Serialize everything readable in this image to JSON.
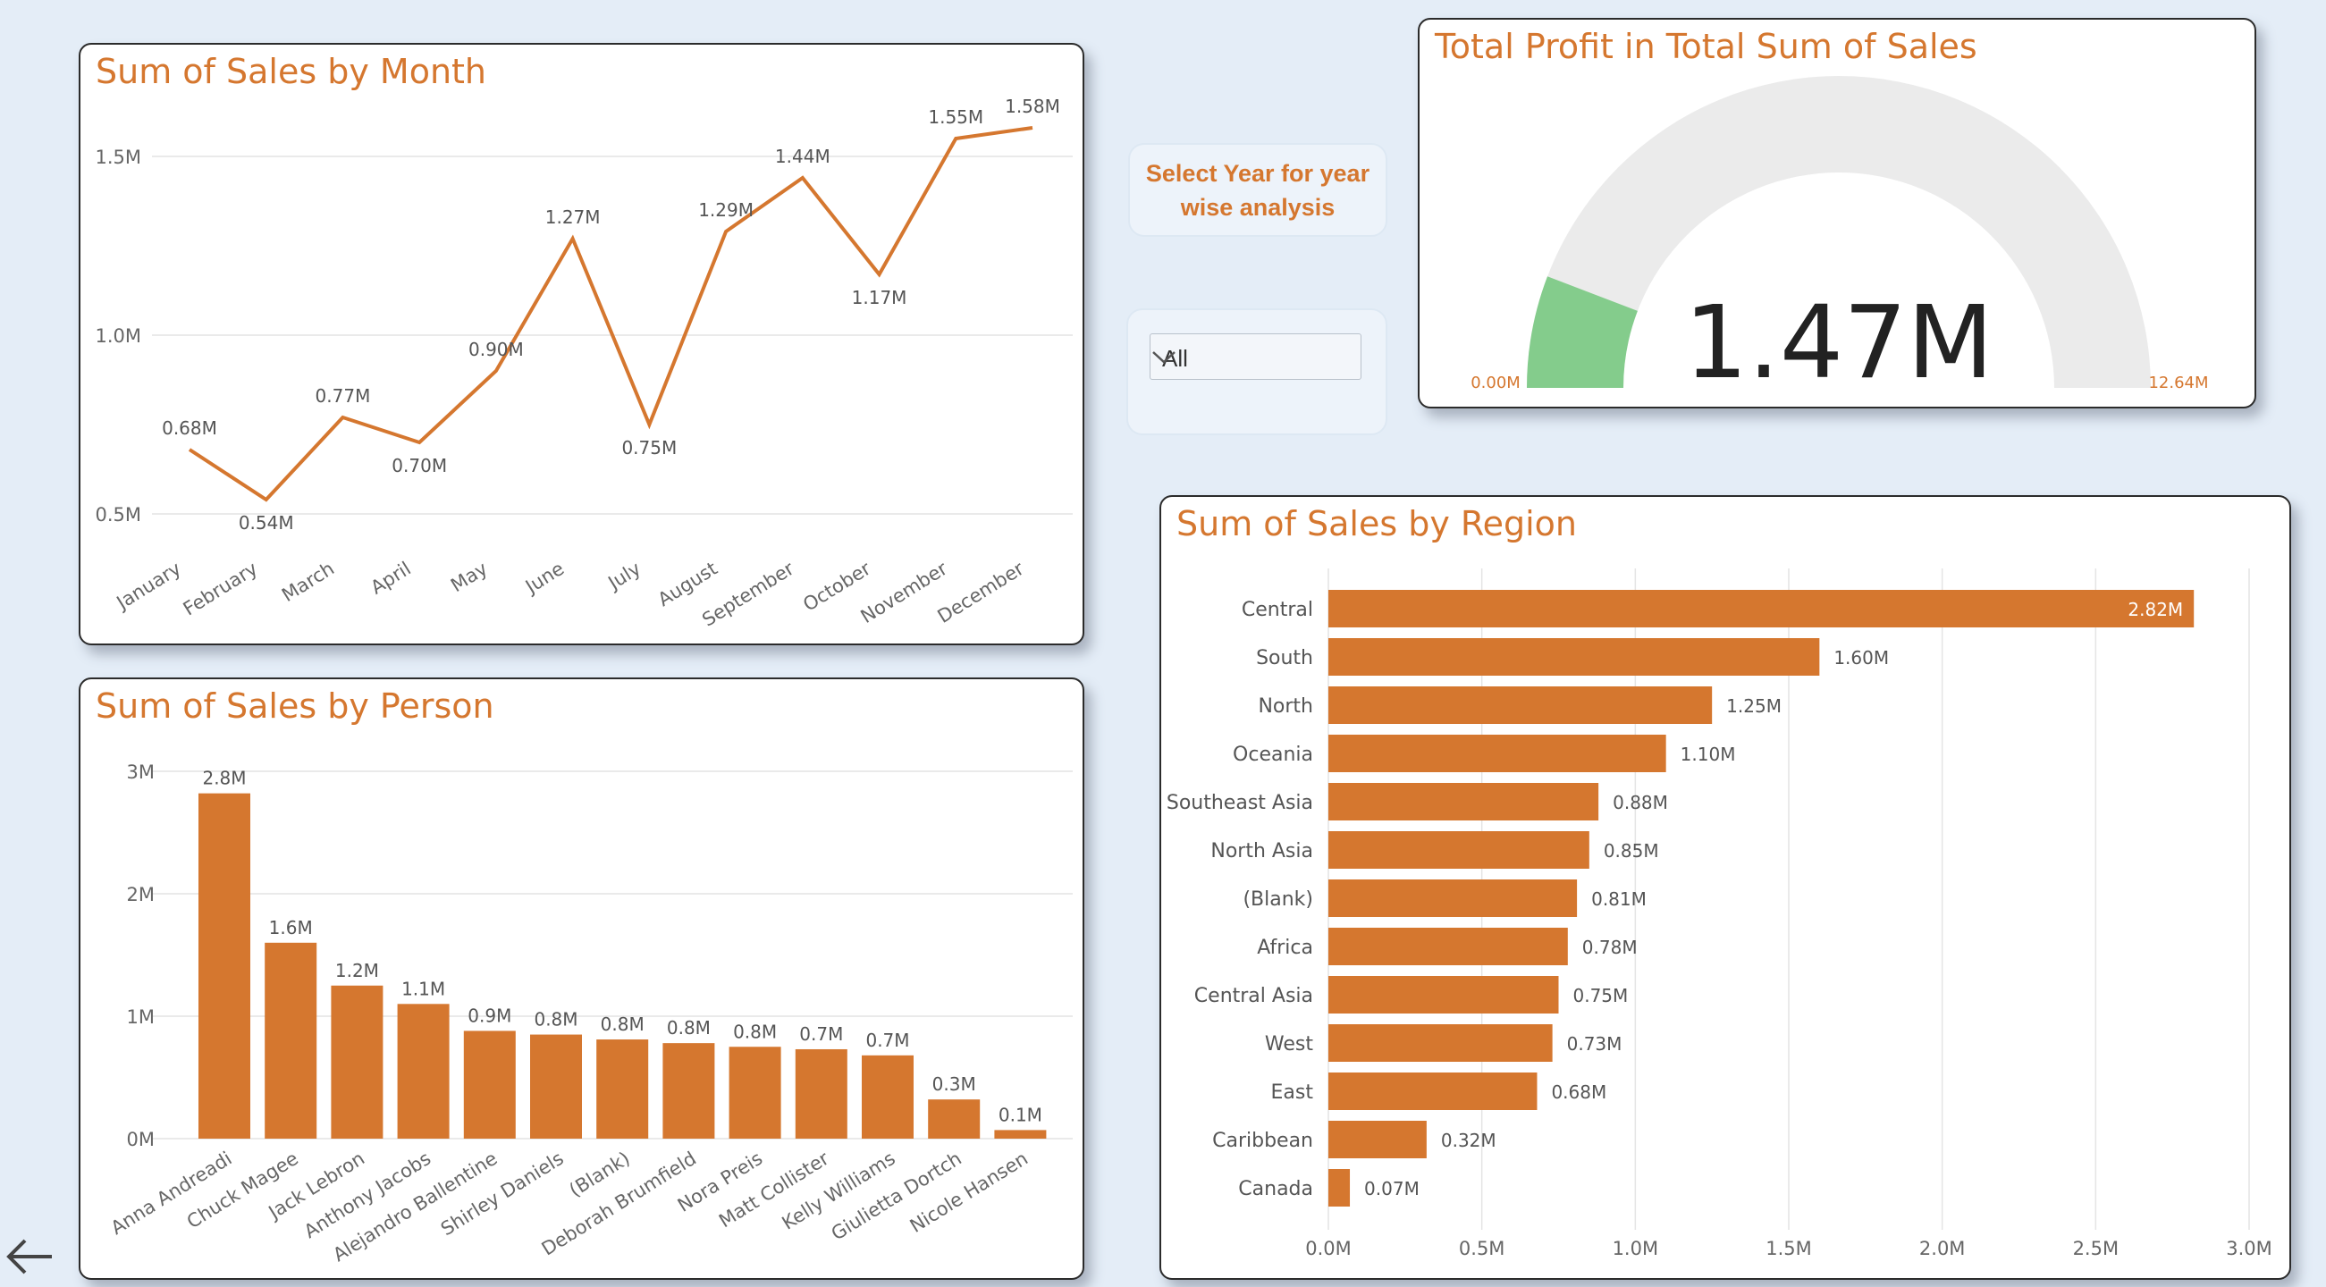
{
  "colors": {
    "accent": "#d5772f",
    "gauge_fill": "#84cc8c",
    "gauge_track": "#ebebeb"
  },
  "month_chart": {
    "title": "Sum of Sales by Month",
    "chart_data": {
      "type": "line",
      "categories": [
        "January",
        "February",
        "March",
        "April",
        "May",
        "June",
        "July",
        "August",
        "September",
        "October",
        "November",
        "December"
      ],
      "values": [
        0.68,
        0.54,
        0.77,
        0.7,
        0.9,
        1.27,
        0.75,
        1.29,
        1.44,
        1.17,
        1.55,
        1.58
      ],
      "value_labels": [
        "0.68M",
        "0.54M",
        "0.77M",
        "0.70M",
        "0.90M",
        "1.27M",
        "0.75M",
        "1.29M",
        "1.44M",
        "1.17M",
        "1.55M",
        "1.58M"
      ],
      "y_ticks": [
        "0.5M",
        "1.0M",
        "1.5M"
      ],
      "ylim": [
        0.5,
        1.5
      ],
      "grid": true
    }
  },
  "slicer": {
    "label": "Select Year for year wise analysis",
    "value": "All"
  },
  "gauge": {
    "title": "Total Profit in Total Sum of Sales",
    "value_label": "1.47M",
    "min_label": "0.00M",
    "max_label": "12.64M",
    "value": 1.47,
    "min": 0,
    "max": 12.64
  },
  "person_chart": {
    "title": "Sum of Sales by Person",
    "chart_data": {
      "type": "bar",
      "categories": [
        "Anna Andreadi",
        "Chuck Magee",
        "Jack Lebron",
        "Anthony Jacobs",
        "Alejandro Ballentine",
        "Shirley Daniels",
        "(Blank)",
        "Deborah Brumfield",
        "Nora Preis",
        "Matt Collister",
        "Kelly Williams",
        "Giulietta Dortch",
        "Nicole Hansen"
      ],
      "values": [
        2.82,
        1.6,
        1.25,
        1.1,
        0.88,
        0.85,
        0.81,
        0.78,
        0.75,
        0.73,
        0.68,
        0.32,
        0.07
      ],
      "value_labels": [
        "2.8M",
        "1.6M",
        "1.2M",
        "1.1M",
        "0.9M",
        "0.8M",
        "0.8M",
        "0.8M",
        "0.8M",
        "0.7M",
        "0.7M",
        "0.3M",
        "0.1M"
      ],
      "y_ticks": [
        "0M",
        "1M",
        "2M",
        "3M"
      ],
      "ylim": [
        0,
        3
      ],
      "grid": true
    }
  },
  "region_chart": {
    "title": "Sum of Sales by Region",
    "chart_data": {
      "type": "bar",
      "orientation": "horizontal",
      "categories": [
        "Central",
        "South",
        "North",
        "Oceania",
        "Southeast Asia",
        "North Asia",
        "(Blank)",
        "Africa",
        "Central Asia",
        "West",
        "East",
        "Caribbean",
        "Canada"
      ],
      "values": [
        2.82,
        1.6,
        1.25,
        1.1,
        0.88,
        0.85,
        0.81,
        0.78,
        0.75,
        0.73,
        0.68,
        0.32,
        0.07
      ],
      "value_labels": [
        "2.82M",
        "1.60M",
        "1.25M",
        "1.10M",
        "0.88M",
        "0.85M",
        "0.81M",
        "0.78M",
        "0.75M",
        "0.73M",
        "0.68M",
        "0.32M",
        "0.07M"
      ],
      "x_ticks": [
        "0.0M",
        "0.5M",
        "1.0M",
        "1.5M",
        "2.0M",
        "2.5M",
        "3.0M"
      ],
      "xlim": [
        0,
        3.0
      ],
      "grid": true
    }
  }
}
